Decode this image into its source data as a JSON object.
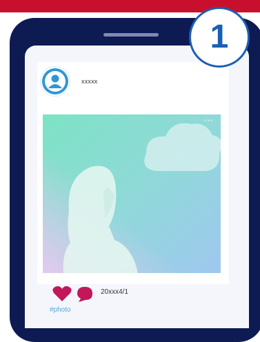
{
  "post": {
    "username": "xxxxx",
    "date": "20xxx4/1",
    "hashtag": "#photo",
    "more": "•••"
  },
  "step_badge": "1",
  "colors": {
    "banner": "#c8102e",
    "phone": "#0d1b52",
    "accent": "#1b5fb4",
    "heart": "#c2185b",
    "hashtag": "#52a8d4"
  },
  "icons": [
    "user-avatar-icon",
    "heart-icon",
    "comment-icon",
    "more-icon"
  ]
}
